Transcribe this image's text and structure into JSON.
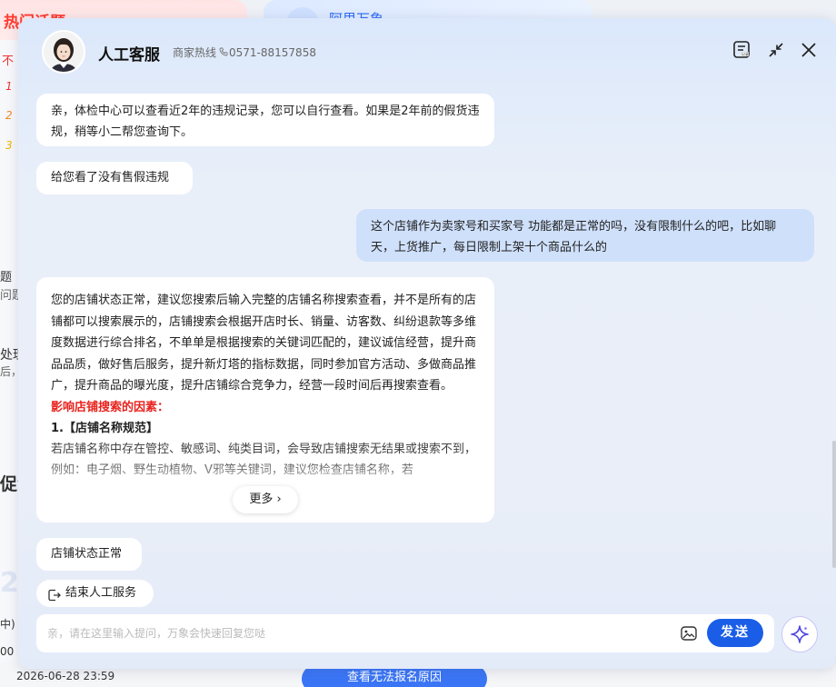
{
  "background": {
    "hot_topics_title": "热门话题",
    "right_card_title": "阿里万象",
    "left_items": [
      {
        "text": "不"
      },
      {
        "text": "1",
        "num": true
      },
      {
        "text": "2",
        "num": true
      },
      {
        "text": "3",
        "num": true
      },
      {
        "text": "题"
      },
      {
        "text": "问题"
      },
      {
        "text": "处理"
      },
      {
        "text": "后，查"
      },
      {
        "text": "促活"
      },
      {
        "text": "2"
      },
      {
        "text": "中)"
      },
      {
        "text": "00"
      }
    ],
    "bottom_date": "2026-06-28 23:59",
    "bottom_button": "查看无法报名原因"
  },
  "chat": {
    "agent_name": "人工客服",
    "hotline_label": "商家热线",
    "hotline_number": "0571-88157858",
    "header_icons": [
      "transcript-icon",
      "minimize-icon",
      "close-icon"
    ],
    "messages": [
      {
        "from": "agent",
        "text": "亲，体检中心可以查看近2年的违规记录，您可以自行查看。如果是2年前的假货违规，稍等小二帮您查询下。"
      },
      {
        "from": "agent",
        "text": "给您看了没有售假违规"
      },
      {
        "from": "user",
        "text": "这个店铺作为卖家号和买家号 功能都是正常的吗，没有限制什么的吧，比如聊天，上货推广，每日限制上架十个商品什么的"
      },
      {
        "from": "agent",
        "text": "您的店铺状态正常，建议您搜索后输入完整的店铺名称搜索查看，并不是所有的店铺都可以搜索展示的，店铺搜索会根据开店时长、销量、访客数、纠纷退款等多维度数据进行综合排名，不单单是根据搜索的关键词匹配的，建议诚信经营，提升商品品质，做好售后服务，提升新灯塔的指标数据，同时参加官方活动、多做商品推广，提升商品的曝光度，提升店铺综合竞争力，经营一段时间后再搜索查看。",
        "section_title": "影响店铺搜索的因素：",
        "rule_title": "1.【店铺名称规范】",
        "rule_text": "若店铺名称中存在管控、敏感词、纯类目词，会导致店铺搜索无结果或搜索不到，例如：电子烟、野生动植物、V邪等关键词，建议您检查店铺名称，若",
        "more_label": "更多"
      },
      {
        "from": "agent",
        "text": "店铺状态正常"
      }
    ],
    "end_service_label": "结束人工服务",
    "input_placeholder": "亲，请在这里输入提问，万象会快速回复您哒",
    "input_value": "",
    "send_label": "发送"
  }
}
